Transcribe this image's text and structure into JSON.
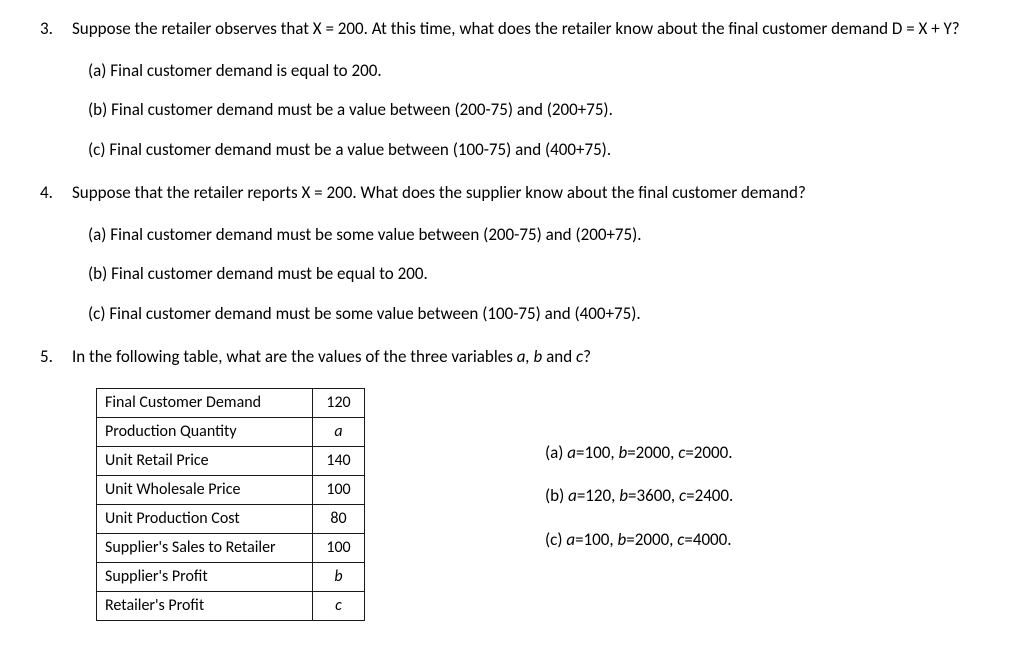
{
  "q3": {
    "num": "3.",
    "text": "Suppose the retailer observes that X = 200. At this time, what does the retailer know about the final customer demand D = X + Y?",
    "options": [
      "(a) Final customer demand is equal to 200.",
      "(b) Final customer demand must be a value between (200-75) and (200+75).",
      "(c) Final customer demand must be a value between (100-75) and (400+75)."
    ]
  },
  "q4": {
    "num": "4.",
    "text": "Suppose that the retailer reports X = 200. What does the supplier know about the final customer demand?",
    "options": [
      "(a)  Final customer demand must be some value between (200-75) and (200+75).",
      "(b)  Final customer demand must be equal to 200.",
      "(c)  Final customer demand must be some value between (100-75) and (400+75)."
    ]
  },
  "q5": {
    "num": "5.",
    "text_pre": "In the following table, what are the values of the three variables ",
    "vars": "a, b",
    "text_mid": " and ",
    "var_c": "c",
    "text_post": "?",
    "table": {
      "rows": [
        {
          "label": "Final Customer Demand",
          "value": "120",
          "italic": false
        },
        {
          "label": "Production Quantity",
          "value": "a",
          "italic": true
        },
        {
          "label": "Unit Retail Price",
          "value": "140",
          "italic": false
        },
        {
          "label": "Unit Wholesale Price",
          "value": "100",
          "italic": false
        },
        {
          "label": "Unit Production Cost",
          "value": "80",
          "italic": false
        },
        {
          "label": "Supplier's Sales to Retailer",
          "value": "100",
          "italic": false
        },
        {
          "label": "Supplier's Profit",
          "value": "b",
          "italic": true
        },
        {
          "label": "Retailer's Profit",
          "value": "c",
          "italic": true
        }
      ]
    },
    "options": [
      {
        "label": "(a) ",
        "a": "a",
        "eq_a": "=100, ",
        "b": "b",
        "eq_b": "=2000, ",
        "c": "c",
        "eq_c": "=2000."
      },
      {
        "label": "(b) ",
        "a": "a",
        "eq_a": "=120, ",
        "b": "b",
        "eq_b": "=3600, ",
        "c": "c",
        "eq_c": "=2400."
      },
      {
        "label": "(c) ",
        "a": "a",
        "eq_a": "=100, ",
        "b": "b",
        "eq_b": "=2000, ",
        "c": "c",
        "eq_c": "=4000."
      }
    ]
  }
}
